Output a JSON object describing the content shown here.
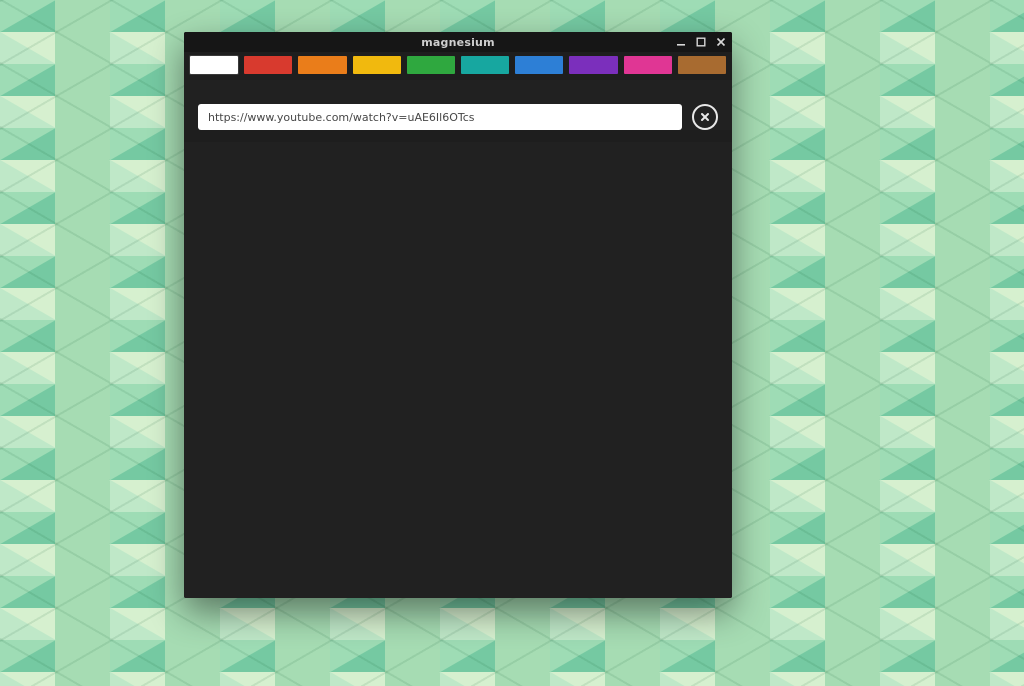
{
  "window": {
    "title": "magnesium"
  },
  "tabs": [
    {
      "color": "#ffffff",
      "active": true
    },
    {
      "color": "#d83a2e",
      "active": false
    },
    {
      "color": "#ea7d1a",
      "active": false
    },
    {
      "color": "#f1b90e",
      "active": false
    },
    {
      "color": "#2fa83f",
      "active": false
    },
    {
      "color": "#17a7a0",
      "active": false
    },
    {
      "color": "#2d7fd6",
      "active": false
    },
    {
      "color": "#7b2fbc",
      "active": false
    },
    {
      "color": "#e03694",
      "active": false
    },
    {
      "color": "#a86b30",
      "active": false
    }
  ],
  "urlbar": {
    "value": "https://www.youtube.com/watch?v=uAE6Il6OTcs",
    "placeholder": ""
  },
  "icons": {
    "minimize": "minimize-icon",
    "maximize": "maximize-icon",
    "close": "close-icon",
    "clear": "close-icon"
  }
}
